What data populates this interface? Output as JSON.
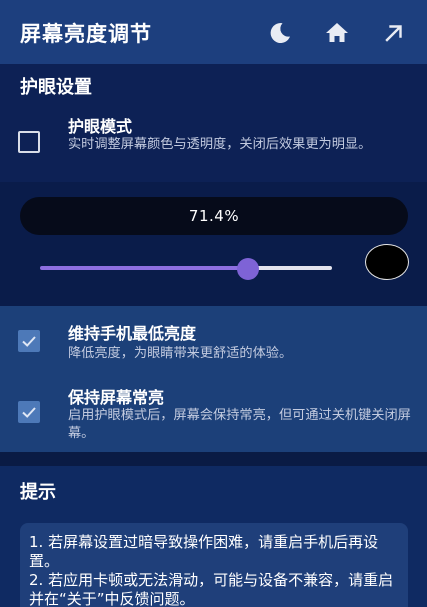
{
  "header": {
    "title": "屏幕亮度调节",
    "icons": [
      "moon-icon",
      "home-icon",
      "arrow-up-right-icon"
    ]
  },
  "eye_section": {
    "title": "护眼设置",
    "eye_mode": {
      "label": "护眼模式",
      "description": "实时调整屏幕颜色与透明度，关闭后效果更为明显。",
      "checked": false
    }
  },
  "brightness": {
    "value_text": "71.4%",
    "level_percent": 71.4,
    "fill_color": "#8e6fe0",
    "selected_color": "#000000"
  },
  "options": [
    {
      "label": "维持手机最低亮度",
      "description": "降低亮度，为眼睛带来更舒适的体验。",
      "checked": true
    },
    {
      "label": "保持屏幕常亮",
      "description": "启用护眼模式后，屏幕会保持常亮，但可通过关机键关闭屏幕。",
      "checked": true
    }
  ],
  "tips": {
    "title": "提示",
    "lines": [
      "1. 若屏幕设置过暗导致操作困难，请重启手机后再设置。",
      "2. 若应用卡顿或无法滑动，可能与设备不兼容，请重启并在“关于”中反馈问题。"
    ]
  },
  "colors": {
    "header_bg": "#1d3f7e",
    "page_bg": "#0b1d4a",
    "checkbox_checked": "#4d79b8"
  }
}
